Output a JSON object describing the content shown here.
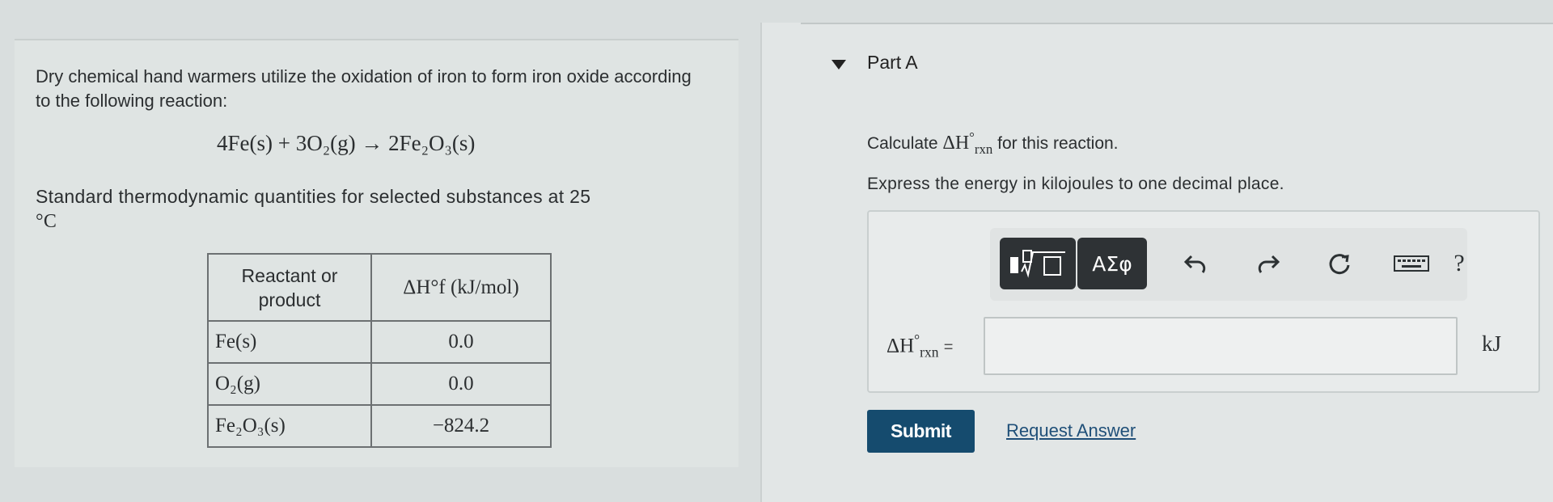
{
  "problem": {
    "intro": "Dry chemical hand warmers utilize the oxidation of iron to form iron oxide according to the following reaction:",
    "reaction": "4Fe(s) + 3O₂(g) → 2Fe₂O₃(s)",
    "thermo_caption": "Standard thermodynamic quantities for selected substances at 25",
    "thermo_caption_unit": "°C",
    "table": {
      "headers": [
        "Reactant or product",
        "ΔH°f (kJ/mol)"
      ],
      "rows": [
        {
          "substance": "Fe(s)",
          "value": "0.0"
        },
        {
          "substance": "O₂(g)",
          "value": "0.0"
        },
        {
          "substance": "Fe₂O₃(s)",
          "value": "−824.2"
        }
      ]
    }
  },
  "part": {
    "title": "Part A",
    "question_prefix": "Calculate",
    "question_suffix": "for this reaction.",
    "instruction": "Express the energy in kilojoules to one decimal place.",
    "quantity_symbol": "ΔH",
    "quantity_sup": "°",
    "quantity_sub": "rxn",
    "equals": "=",
    "unit": "kJ",
    "answer_value": ""
  },
  "toolbar": {
    "templates_icon": "templates-icon",
    "greek_label": "ΑΣφ",
    "undo_icon": "undo-icon",
    "redo_icon": "redo-icon",
    "reset_icon": "reset-icon",
    "keyboard_icon": "keyboard-icon",
    "help_label": "?"
  },
  "actions": {
    "submit_label": "Submit",
    "request_answer_label": "Request Answer"
  },
  "colors": {
    "submit_bg": "#154b6e",
    "link": "#1f4f78",
    "toolbar_button": "#2e3235"
  }
}
